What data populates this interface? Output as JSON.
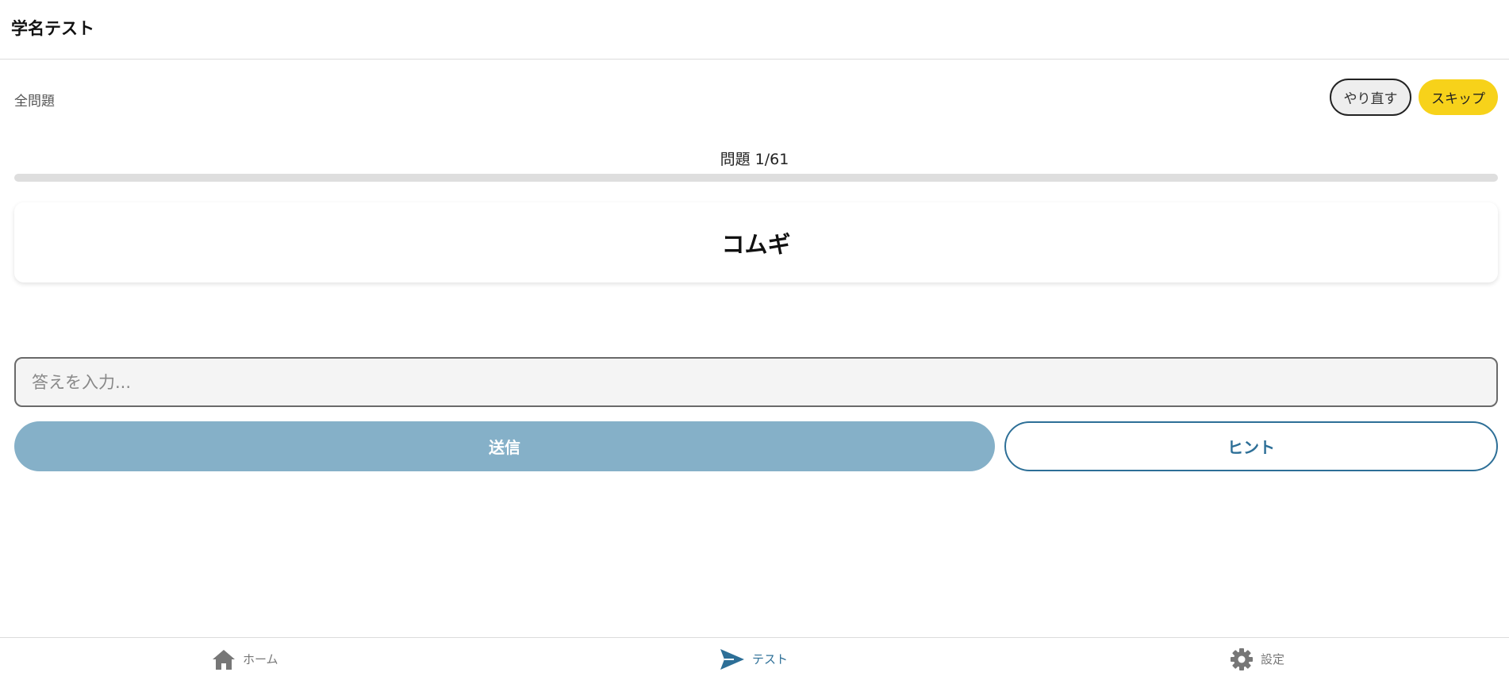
{
  "header": {
    "title": "学名テスト"
  },
  "filter": {
    "label": "全問題"
  },
  "actions": {
    "retry_label": "やり直す",
    "skip_label": "スキップ"
  },
  "progress": {
    "label": "問題 1/61",
    "current": 1,
    "total": 61
  },
  "question": {
    "text": "コムギ"
  },
  "answer": {
    "placeholder": "答えを入力...",
    "value": ""
  },
  "buttons": {
    "submit_label": "送信",
    "hint_label": "ヒント"
  },
  "nav": {
    "items": [
      {
        "label": "ホーム",
        "icon": "home-icon",
        "active": false
      },
      {
        "label": "テスト",
        "icon": "send-icon",
        "active": true
      },
      {
        "label": "設定",
        "icon": "gear-icon",
        "active": false
      }
    ]
  },
  "colors": {
    "accent": "#2d6f97",
    "skip": "#f7d21a",
    "submit_disabled": "#85b0c8",
    "inactive_nav": "#777777"
  }
}
